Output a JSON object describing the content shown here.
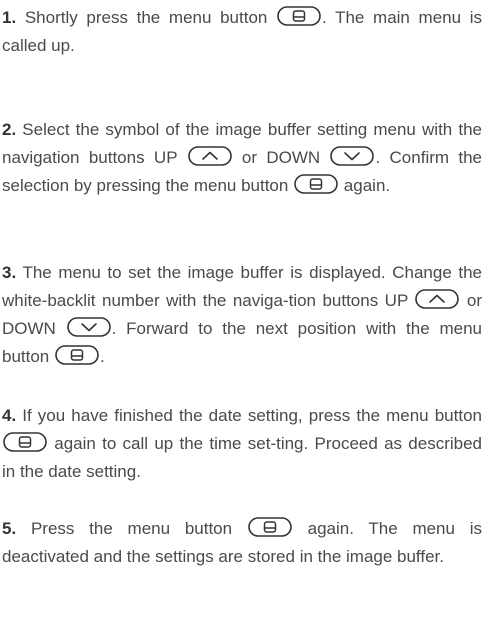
{
  "steps": [
    {
      "num": "1.",
      "parts": [
        {
          "t": "text",
          "v": " Shortly press the menu button "
        },
        {
          "t": "icon",
          "v": "menu-button-icon"
        },
        {
          "t": "text",
          "v": ". The main menu is called up."
        }
      ]
    },
    {
      "num": "2.",
      "parts": [
        {
          "t": "text",
          "v": " Select the symbol of the image buffer setting menu with the navigation buttons UP "
        },
        {
          "t": "icon",
          "v": "up-button-icon"
        },
        {
          "t": "text",
          "v": " or DOWN "
        },
        {
          "t": "icon",
          "v": "down-button-icon"
        },
        {
          "t": "text",
          "v": ". Confirm the selection by pressing the menu button "
        },
        {
          "t": "icon",
          "v": "menu-button-icon"
        },
        {
          "t": "text",
          "v": " again."
        }
      ]
    },
    {
      "num": "3.",
      "parts": [
        {
          "t": "text",
          "v": " The menu to set the image buffer is displayed. Change the white-backlit number with the naviga-tion buttons UP "
        },
        {
          "t": "icon",
          "v": "up-button-icon"
        },
        {
          "t": "text",
          "v": " or DOWN "
        },
        {
          "t": "icon",
          "v": "down-button-icon"
        },
        {
          "t": "text",
          "v": ". Forward to the next position with the menu button "
        },
        {
          "t": "icon",
          "v": "menu-button-icon"
        },
        {
          "t": "text",
          "v": "."
        }
      ]
    },
    {
      "num": "4.",
      "parts": [
        {
          "t": "text",
          "v": " If you have finished the date setting, press the menu button "
        },
        {
          "t": "icon",
          "v": "menu-button-icon"
        },
        {
          "t": "text",
          "v": " again to call up the time set-ting. Proceed as described in the date setting."
        }
      ]
    },
    {
      "num": "5.",
      "parts": [
        {
          "t": "text",
          "v": " Press the menu button "
        },
        {
          "t": "icon",
          "v": "menu-button-icon"
        },
        {
          "t": "text",
          "v": " again. The menu is deactivated and the settings are stored in the image buffer."
        }
      ]
    }
  ],
  "colors": {
    "text": "#4a4a4a",
    "step_number": "#333333",
    "icon_stroke": "#333333"
  }
}
